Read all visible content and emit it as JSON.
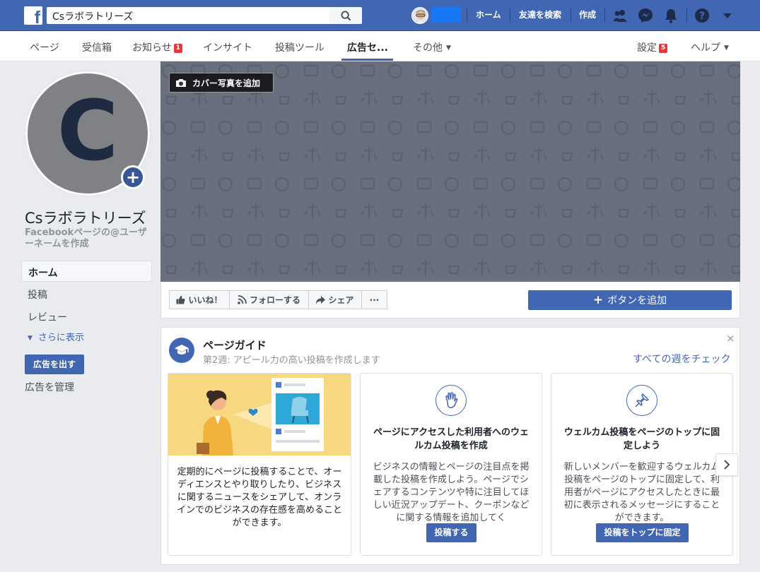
{
  "topbar": {
    "search_value": "Csラボラトリーズ",
    "nav": [
      "ホーム",
      "友達を検索",
      "作成"
    ],
    "icons": [
      "friend-requests-icon",
      "messenger-icon",
      "notifications-icon",
      "help-icon",
      "account-menu-icon"
    ]
  },
  "page_nav": {
    "items": [
      "ページ",
      "受信箱",
      "お知らせ",
      "インサイト",
      "投稿ツール",
      "広告セ...",
      "その他"
    ],
    "notifications_badge": "1",
    "settings": "設定",
    "settings_badge": "5",
    "help": "ヘルプ"
  },
  "profile": {
    "letter": "C",
    "name": "Csラボラトリーズ",
    "username_prompt": "Facebookページの@ユーザーネームを作成"
  },
  "left_nav": {
    "items": [
      "ホーム",
      "投稿",
      "レビュー"
    ],
    "more": "さらに表示",
    "ad_button": "広告を出す",
    "manage_ads": "広告を管理"
  },
  "cover": {
    "add_cover": "カバー写真を追加"
  },
  "actions": {
    "like": "いいね！",
    "follow": "フォローする",
    "share": "シェア",
    "more": "···",
    "add_button": "ボタンを追加"
  },
  "guide": {
    "title": "ページガイド",
    "subtitle": "第2週: アピール力の高い投稿を作成します",
    "check_all": "すべての週をチェック",
    "close": "×",
    "card1_text": "定期的にページに投稿することで、オーディエンスとやり取りしたり、ビジネスに関するニュースをシェアして、オンラインでのビジネスの存在感を高めることができます。",
    "card2": {
      "title": "ページにアクセスした利用者へのウェルカム投稿を作成",
      "body": "ビジネスの情報とページの注目点を掲載した投稿を作成しよう。ページでシェアするコンテンツや特に注目してほしい近況アップデート、クーポンなどに関する情報を追加してく",
      "button": "投稿する"
    },
    "card3": {
      "title": "ウェルカム投稿をページのトップに固定しよう",
      "body": "新しいメンバーを歓迎するウェルカム投稿をページのトップに固定して、利用者がページにアクセスしたときに最初に表示されるメッセージにすることができます。",
      "button": "投稿をトップに固定"
    }
  },
  "colors": {
    "brand": "#4267b2",
    "badge": "#e0393e",
    "cover": "#6a6f7d",
    "illustration": "#f7d77f"
  }
}
